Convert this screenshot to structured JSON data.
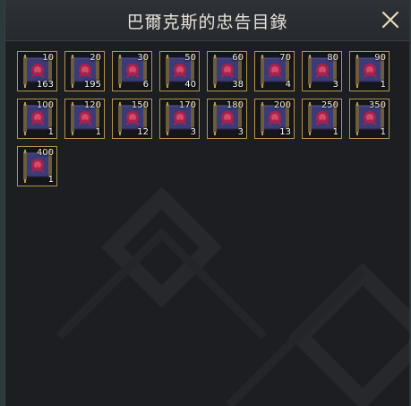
{
  "window": {
    "title": "巴爾克斯的忠告目錄",
    "close_icon": "close-x-icon"
  },
  "colors": {
    "slot_border": "#b8954f",
    "scroll_body": "#3a3a7a",
    "scroll_seal": "#a8234a"
  },
  "items": [
    {
      "level": "10",
      "count": "163"
    },
    {
      "level": "20",
      "count": "195"
    },
    {
      "level": "30",
      "count": "6"
    },
    {
      "level": "50",
      "count": "40"
    },
    {
      "level": "60",
      "count": "38"
    },
    {
      "level": "70",
      "count": "4"
    },
    {
      "level": "80",
      "count": "3"
    },
    {
      "level": "90",
      "count": "1"
    },
    {
      "level": "100",
      "count": "1"
    },
    {
      "level": "120",
      "count": "1"
    },
    {
      "level": "150",
      "count": "12"
    },
    {
      "level": "170",
      "count": "3"
    },
    {
      "level": "180",
      "count": "3"
    },
    {
      "level": "200",
      "count": "13"
    },
    {
      "level": "250",
      "count": "1"
    },
    {
      "level": "350",
      "count": "1"
    },
    {
      "level": "400",
      "count": "1"
    }
  ]
}
